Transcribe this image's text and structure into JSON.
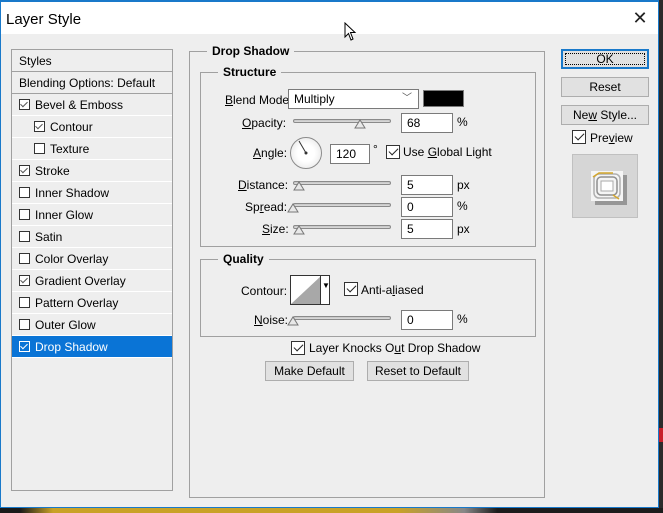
{
  "window": {
    "title": "Layer Style",
    "close_icon": "close-icon"
  },
  "styles_panel": {
    "header": "Styles",
    "blending_options": "Blending Options: Default",
    "items": [
      {
        "label": "Bevel & Emboss",
        "checked": true,
        "indent": false,
        "selected": false
      },
      {
        "label": "Contour",
        "checked": true,
        "indent": true,
        "selected": false
      },
      {
        "label": "Texture",
        "checked": false,
        "indent": true,
        "selected": false
      },
      {
        "label": "Stroke",
        "checked": true,
        "indent": false,
        "selected": false
      },
      {
        "label": "Inner Shadow",
        "checked": false,
        "indent": false,
        "selected": false
      },
      {
        "label": "Inner Glow",
        "checked": false,
        "indent": false,
        "selected": false
      },
      {
        "label": "Satin",
        "checked": false,
        "indent": false,
        "selected": false
      },
      {
        "label": "Color Overlay",
        "checked": false,
        "indent": false,
        "selected": false
      },
      {
        "label": "Gradient Overlay",
        "checked": true,
        "indent": false,
        "selected": false
      },
      {
        "label": "Pattern Overlay",
        "checked": false,
        "indent": false,
        "selected": false
      },
      {
        "label": "Outer Glow",
        "checked": false,
        "indent": false,
        "selected": false
      },
      {
        "label": "Drop Shadow",
        "checked": true,
        "indent": false,
        "selected": true
      }
    ]
  },
  "drop_shadow": {
    "title": "Drop Shadow",
    "structure": {
      "title": "Structure",
      "blend_mode_label": "Blend Mode:",
      "blend_mode_value": "Multiply",
      "shadow_color": "#000000",
      "opacity_label": "Opacity:",
      "opacity_value": "68",
      "opacity_unit": "%",
      "opacity_fraction": 0.68,
      "angle_label": "Angle:",
      "angle_value": "120",
      "angle_unit": "°",
      "use_global_light_label": "Use Global Light",
      "use_global_light_checked": true,
      "distance_label": "Distance:",
      "distance_value": "5",
      "distance_unit": "px",
      "spread_label": "Spread:",
      "spread_value": "0",
      "spread_unit": "%",
      "size_label": "Size:",
      "size_value": "5",
      "size_unit": "px"
    },
    "quality": {
      "title": "Quality",
      "contour_label": "Contour:",
      "anti_aliased_label": "Anti-aliased",
      "anti_aliased_checked": true,
      "noise_label": "Noise:",
      "noise_value": "0",
      "noise_unit": "%"
    },
    "layer_knocks_out_label": "Layer Knocks Out Drop Shadow",
    "layer_knocks_out_checked": true,
    "make_default_label": "Make Default",
    "reset_to_default_label": "Reset to Default"
  },
  "actions": {
    "ok_label": "OK",
    "reset_label": "Reset",
    "new_style_label": "New Style...",
    "preview_label": "Preview",
    "preview_checked": true
  }
}
